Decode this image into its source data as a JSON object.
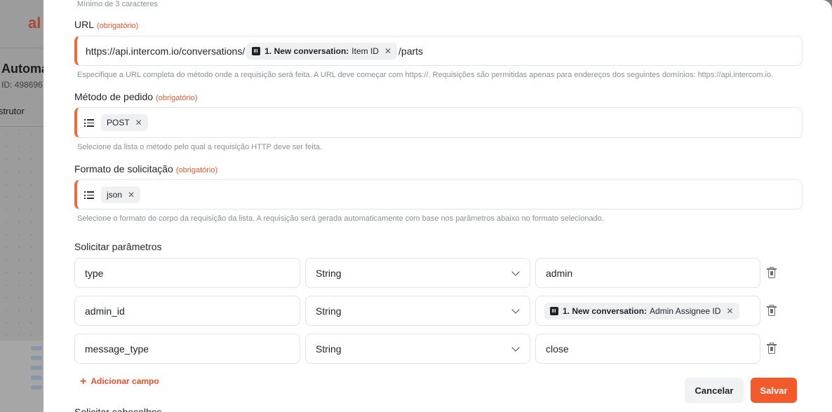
{
  "background": {
    "logo": "al",
    "title": "Automa",
    "id_text": "ID: 498696",
    "tab": "strutor"
  },
  "form": {
    "top_helper": "Mínimo de 3 caracteres",
    "required_tag": "(obrigatório)",
    "url": {
      "label": "URL",
      "prefix": "https://api.intercom.io/conversations/",
      "chip_bold": "1. New conversation:",
      "chip_text": "Item ID",
      "suffix": "/parts",
      "helper": "Especifique a URL completa do método onde a requisição será feita. A URL deve começar com https://. Requisições são permitidas apenas para endereços dos seguintes domínios: https://api.intercom.io."
    },
    "method": {
      "label": "Método de pedido",
      "value": "POST",
      "helper": "Selecione da lista o método pelo qual a requisição HTTP deve ser feita."
    },
    "format": {
      "label": "Formato de solicitação",
      "value": "json",
      "helper": "Selecione o formato do corpo da requisição da lista. A requisição será gerada automaticamente com base nos parâmetros abaixo no formato selecionado."
    },
    "params": {
      "label": "Solicitar parâmetros",
      "rows": [
        {
          "key": "type",
          "type": "String",
          "value": "admin"
        },
        {
          "key": "admin_id",
          "type": "String",
          "value_chip_bold": "1. New conversation:",
          "value_chip_text": "Admin Assignee ID"
        },
        {
          "key": "message_type",
          "type": "String",
          "value": "close"
        }
      ],
      "add_label": "Adicionar campo"
    },
    "headers_label": "Solicitar cabeçalhos"
  },
  "actions": {
    "cancel": "Cancelar",
    "save": "Salvar"
  },
  "colors": {
    "accent": "#ef6b3d",
    "save_bg": "#f25a2b",
    "cancel_bg": "#f1f2f4"
  }
}
